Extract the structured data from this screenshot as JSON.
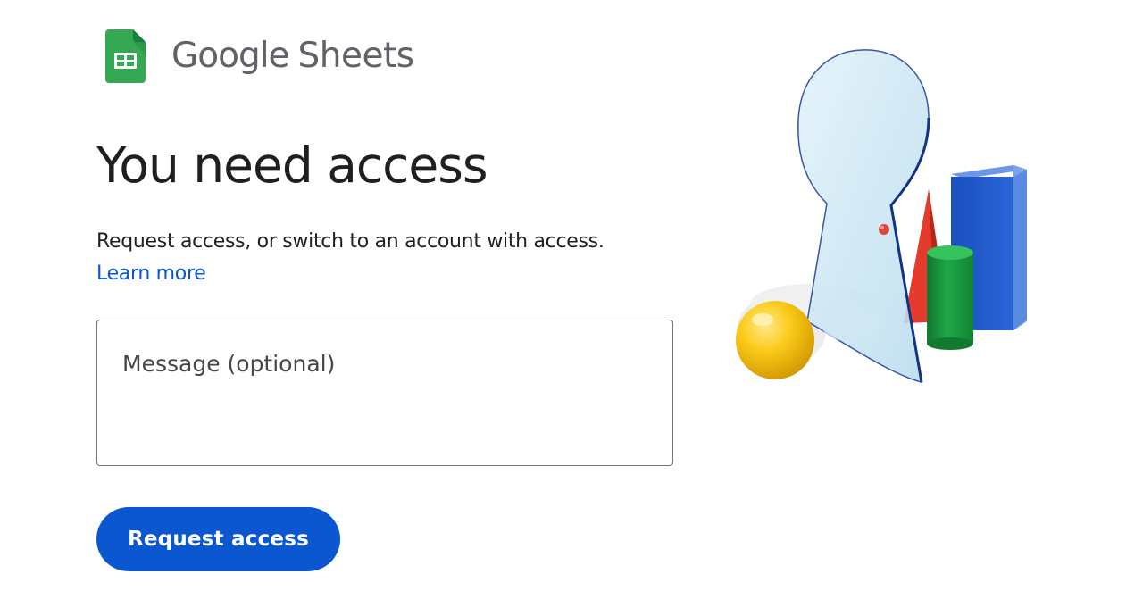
{
  "header": {
    "brand_word_1": "Google",
    "brand_word_2": "Sheets",
    "logo_icon": "sheets-logo-icon"
  },
  "main": {
    "title": "You need access",
    "description": "Request access, or switch to an account with access.",
    "learn_more_label": "Learn more",
    "message_placeholder": "Message (optional)",
    "message_value": "",
    "request_button_label": "Request access"
  },
  "illustration": {
    "icon": "keyhole-shapes-illustration"
  },
  "colors": {
    "accent": "#0b57d0",
    "sheets_green": "#34a853",
    "text_primary": "#1f1f1f",
    "brand_gray": "#5f6368"
  }
}
